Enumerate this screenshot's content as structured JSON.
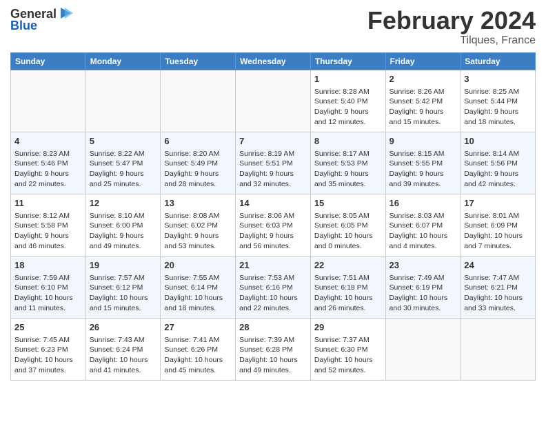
{
  "header": {
    "logo_general": "General",
    "logo_blue": "Blue",
    "month": "February 2024",
    "location": "Tilques, France"
  },
  "days_of_week": [
    "Sunday",
    "Monday",
    "Tuesday",
    "Wednesday",
    "Thursday",
    "Friday",
    "Saturday"
  ],
  "weeks": [
    [
      {
        "day": "",
        "info": ""
      },
      {
        "day": "",
        "info": ""
      },
      {
        "day": "",
        "info": ""
      },
      {
        "day": "",
        "info": ""
      },
      {
        "day": "1",
        "info": "Sunrise: 8:28 AM\nSunset: 5:40 PM\nDaylight: 9 hours\nand 12 minutes."
      },
      {
        "day": "2",
        "info": "Sunrise: 8:26 AM\nSunset: 5:42 PM\nDaylight: 9 hours\nand 15 minutes."
      },
      {
        "day": "3",
        "info": "Sunrise: 8:25 AM\nSunset: 5:44 PM\nDaylight: 9 hours\nand 18 minutes."
      }
    ],
    [
      {
        "day": "4",
        "info": "Sunrise: 8:23 AM\nSunset: 5:46 PM\nDaylight: 9 hours\nand 22 minutes."
      },
      {
        "day": "5",
        "info": "Sunrise: 8:22 AM\nSunset: 5:47 PM\nDaylight: 9 hours\nand 25 minutes."
      },
      {
        "day": "6",
        "info": "Sunrise: 8:20 AM\nSunset: 5:49 PM\nDaylight: 9 hours\nand 28 minutes."
      },
      {
        "day": "7",
        "info": "Sunrise: 8:19 AM\nSunset: 5:51 PM\nDaylight: 9 hours\nand 32 minutes."
      },
      {
        "day": "8",
        "info": "Sunrise: 8:17 AM\nSunset: 5:53 PM\nDaylight: 9 hours\nand 35 minutes."
      },
      {
        "day": "9",
        "info": "Sunrise: 8:15 AM\nSunset: 5:55 PM\nDaylight: 9 hours\nand 39 minutes."
      },
      {
        "day": "10",
        "info": "Sunrise: 8:14 AM\nSunset: 5:56 PM\nDaylight: 9 hours\nand 42 minutes."
      }
    ],
    [
      {
        "day": "11",
        "info": "Sunrise: 8:12 AM\nSunset: 5:58 PM\nDaylight: 9 hours\nand 46 minutes."
      },
      {
        "day": "12",
        "info": "Sunrise: 8:10 AM\nSunset: 6:00 PM\nDaylight: 9 hours\nand 49 minutes."
      },
      {
        "day": "13",
        "info": "Sunrise: 8:08 AM\nSunset: 6:02 PM\nDaylight: 9 hours\nand 53 minutes."
      },
      {
        "day": "14",
        "info": "Sunrise: 8:06 AM\nSunset: 6:03 PM\nDaylight: 9 hours\nand 56 minutes."
      },
      {
        "day": "15",
        "info": "Sunrise: 8:05 AM\nSunset: 6:05 PM\nDaylight: 10 hours\nand 0 minutes."
      },
      {
        "day": "16",
        "info": "Sunrise: 8:03 AM\nSunset: 6:07 PM\nDaylight: 10 hours\nand 4 minutes."
      },
      {
        "day": "17",
        "info": "Sunrise: 8:01 AM\nSunset: 6:09 PM\nDaylight: 10 hours\nand 7 minutes."
      }
    ],
    [
      {
        "day": "18",
        "info": "Sunrise: 7:59 AM\nSunset: 6:10 PM\nDaylight: 10 hours\nand 11 minutes."
      },
      {
        "day": "19",
        "info": "Sunrise: 7:57 AM\nSunset: 6:12 PM\nDaylight: 10 hours\nand 15 minutes."
      },
      {
        "day": "20",
        "info": "Sunrise: 7:55 AM\nSunset: 6:14 PM\nDaylight: 10 hours\nand 18 minutes."
      },
      {
        "day": "21",
        "info": "Sunrise: 7:53 AM\nSunset: 6:16 PM\nDaylight: 10 hours\nand 22 minutes."
      },
      {
        "day": "22",
        "info": "Sunrise: 7:51 AM\nSunset: 6:18 PM\nDaylight: 10 hours\nand 26 minutes."
      },
      {
        "day": "23",
        "info": "Sunrise: 7:49 AM\nSunset: 6:19 PM\nDaylight: 10 hours\nand 30 minutes."
      },
      {
        "day": "24",
        "info": "Sunrise: 7:47 AM\nSunset: 6:21 PM\nDaylight: 10 hours\nand 33 minutes."
      }
    ],
    [
      {
        "day": "25",
        "info": "Sunrise: 7:45 AM\nSunset: 6:23 PM\nDaylight: 10 hours\nand 37 minutes."
      },
      {
        "day": "26",
        "info": "Sunrise: 7:43 AM\nSunset: 6:24 PM\nDaylight: 10 hours\nand 41 minutes."
      },
      {
        "day": "27",
        "info": "Sunrise: 7:41 AM\nSunset: 6:26 PM\nDaylight: 10 hours\nand 45 minutes."
      },
      {
        "day": "28",
        "info": "Sunrise: 7:39 AM\nSunset: 6:28 PM\nDaylight: 10 hours\nand 49 minutes."
      },
      {
        "day": "29",
        "info": "Sunrise: 7:37 AM\nSunset: 6:30 PM\nDaylight: 10 hours\nand 52 minutes."
      },
      {
        "day": "",
        "info": ""
      },
      {
        "day": "",
        "info": ""
      }
    ]
  ]
}
